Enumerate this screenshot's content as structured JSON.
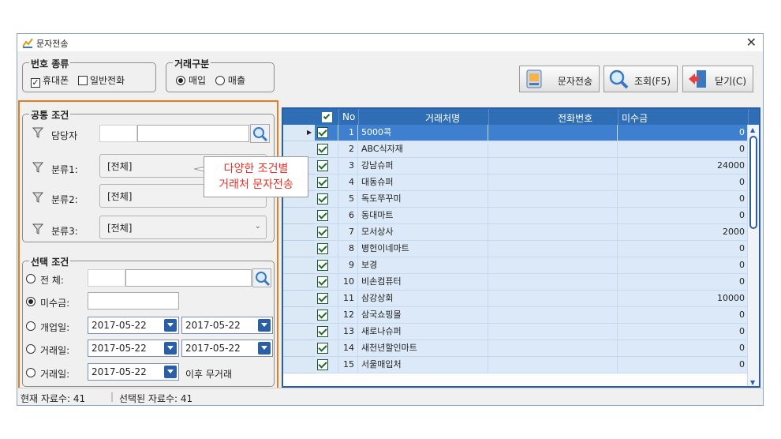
{
  "window": {
    "title": "문자전송"
  },
  "group_number_type": {
    "legend": "번호 종류",
    "mobile": "휴대폰",
    "landline": "일반전화"
  },
  "group_trade_type": {
    "legend": "거래구분",
    "purchase": "매입",
    "sale": "매출"
  },
  "toolbar": {
    "send_label": "문자전송",
    "search_label": "조회(F5)",
    "close_label": "닫기(C)"
  },
  "common_conditions": {
    "legend": "공통 조건",
    "manager_label": "담당자",
    "cat1_label": "분류1:",
    "cat1_value": "[전체]",
    "cat2_label": "분류2:",
    "cat2_value": "[전체]",
    "cat3_label": "분류3:",
    "cat3_value": "[전체]"
  },
  "select_conditions": {
    "legend": "선택 조건",
    "all_label": "전 체:",
    "receivable_label": "미수금:",
    "open_label": "개업일:",
    "open_from": "2017-05-22",
    "open_to": "2017-05-22",
    "trade_label": "거래일:",
    "trade_from": "2017-05-22",
    "trade_to": "2017-05-22",
    "trade2_label": "거래일:",
    "trade2_from": "2017-05-22",
    "no_trade_after": "이후 무거래"
  },
  "callout": {
    "line1": "다양한 조건별",
    "line2": "거래처 문자전송"
  },
  "grid": {
    "headers": {
      "no": "No",
      "name": "거래처명",
      "phone": "전화번호",
      "receivable": "미수금"
    },
    "rows": [
      {
        "no": "1",
        "name": "5000콕",
        "phone": "",
        "amount": "0"
      },
      {
        "no": "2",
        "name": "ABC식자재",
        "phone": "",
        "amount": "0"
      },
      {
        "no": "3",
        "name": "강남슈퍼",
        "phone": "",
        "amount": "24000"
      },
      {
        "no": "4",
        "name": "대동슈퍼",
        "phone": "",
        "amount": "0"
      },
      {
        "no": "5",
        "name": "독도쭈꾸미",
        "phone": "",
        "amount": "0"
      },
      {
        "no": "6",
        "name": "동대마트",
        "phone": "",
        "amount": "0"
      },
      {
        "no": "7",
        "name": "모서상사",
        "phone": "",
        "amount": "2000"
      },
      {
        "no": "8",
        "name": "병헌이네마트",
        "phone": "",
        "amount": "0"
      },
      {
        "no": "9",
        "name": "보경",
        "phone": "",
        "amount": "0"
      },
      {
        "no": "10",
        "name": "비손컴퓨터",
        "phone": "",
        "amount": "0"
      },
      {
        "no": "11",
        "name": "삼강상회",
        "phone": "",
        "amount": "10000"
      },
      {
        "no": "12",
        "name": "삼국쇼핑몰",
        "phone": "",
        "amount": "0"
      },
      {
        "no": "13",
        "name": "새로나슈퍼",
        "phone": "",
        "amount": "0"
      },
      {
        "no": "14",
        "name": "새천년할인마트",
        "phone": "",
        "amount": "0"
      },
      {
        "no": "15",
        "name": "서울매입처",
        "phone": "",
        "amount": "0"
      }
    ]
  },
  "status": {
    "current": "현재 자료수: 41",
    "selected": "선택된 자료수: 41"
  }
}
